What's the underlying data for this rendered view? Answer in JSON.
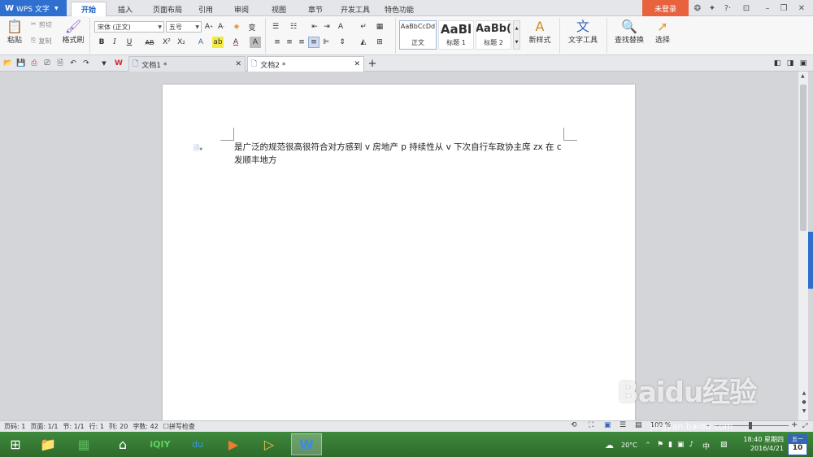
{
  "app": {
    "menu_label": "WPS 文字",
    "login_label": "未登录"
  },
  "ribbon_tabs": [
    "开始",
    "插入",
    "页面布局",
    "引用",
    "审阅",
    "视图",
    "章节",
    "开发工具",
    "特色功能"
  ],
  "clipboard": {
    "paste": "粘贴",
    "cut": "剪切",
    "copy": "复制",
    "format_painter": "格式刷"
  },
  "font": {
    "name": "宋体 (正文)",
    "size": "五号"
  },
  "styles": [
    {
      "preview": "AaBbCcDd",
      "label": "正文"
    },
    {
      "preview": "AaBl",
      "label": "标题 1"
    },
    {
      "preview": "AaBb(",
      "label": "标题 2"
    }
  ],
  "tools": {
    "new_style": "新样式",
    "text_tools": "文字工具",
    "find_replace": "查找替换",
    "select": "选择"
  },
  "doc_tabs": [
    {
      "label": "文档1 *"
    },
    {
      "label": "文档2 *"
    }
  ],
  "document": {
    "text": "是广泛的规范很高很符合对方感到 v 房地产 p 持续性从 v 下次自行车政协主席 zx 在 c 发顺丰地方"
  },
  "status": {
    "page_num": "页码: 1",
    "pages": "页面: 1/1",
    "section": "节: 1/1",
    "row": "行: 1",
    "col": "列: 20",
    "word_count": "字数: 42",
    "spell_check": "拼写检查",
    "zoom": "100 %"
  },
  "taskbar": {
    "temperature": "20°C",
    "ime": "中",
    "time": "18:40 星期四",
    "date": "2016/4/21",
    "cal_weekday": "五一",
    "cal_day": "10"
  },
  "watermark": {
    "brand": "Baidu经验",
    "url": "jingyan.baidu.com"
  },
  "colors": {
    "accent": "#2f6fcf",
    "login": "#e8623e",
    "taskbar": "#3f8a3d"
  }
}
